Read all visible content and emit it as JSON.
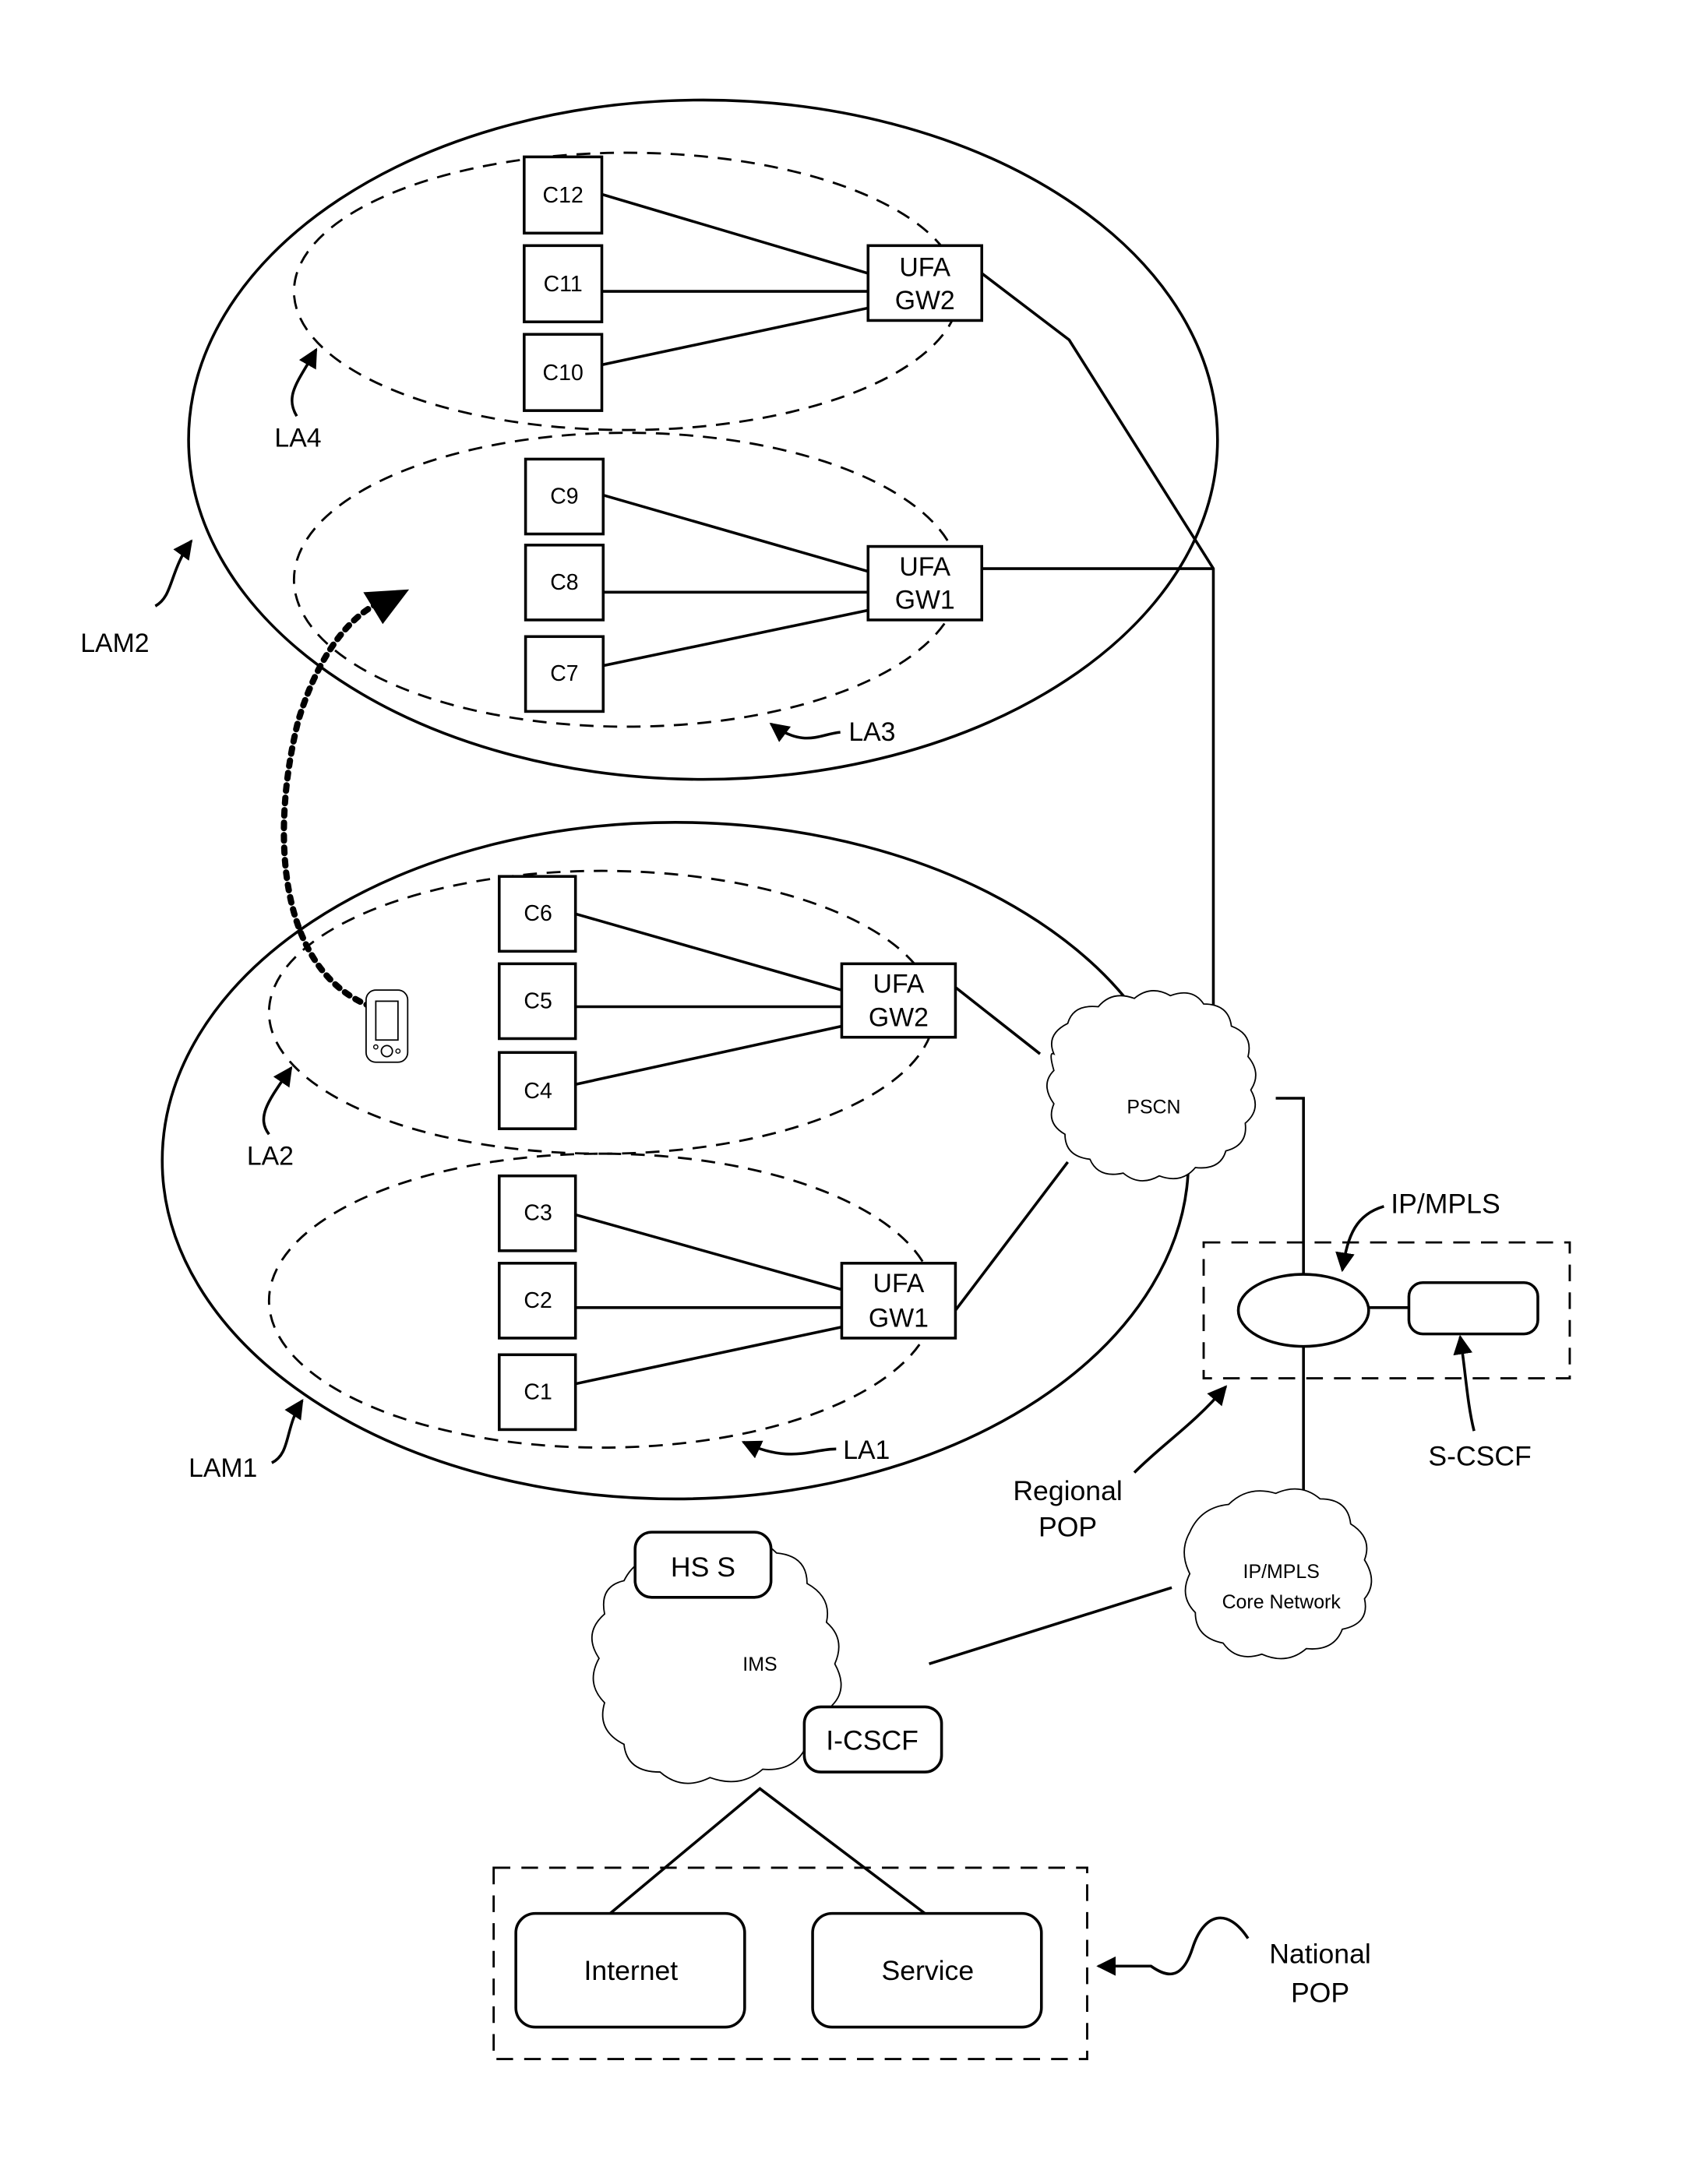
{
  "diagram": {
    "title": "",
    "lam2": {
      "label": "LAM2",
      "la4": {
        "label": "LA4",
        "cells": [
          "C12",
          "C11",
          "C10"
        ],
        "gateway": [
          "UFA",
          "GW2"
        ]
      },
      "la3": {
        "label": "LA3",
        "cells": [
          "C9",
          "C8",
          "C7"
        ],
        "gateway": [
          "UFA",
          "GW1"
        ]
      }
    },
    "lam1": {
      "label": "LAM1",
      "la2": {
        "label": "LA2",
        "cells": [
          "C6",
          "C5",
          "C4"
        ],
        "gateway": [
          "UFA",
          "GW2"
        ]
      },
      "la1": {
        "label": "LA1",
        "cells": [
          "C3",
          "C2",
          "C1"
        ],
        "gateway": [
          "UFA",
          "GW1"
        ]
      }
    },
    "pscn": "PSCN",
    "ip_mpls": "IP/MPLS",
    "s_cscf": "S-CSCF",
    "regional_pop": [
      "Regional",
      "POP"
    ],
    "core": [
      "IP/MPLS",
      "Core Network"
    ],
    "ims": {
      "label": "IMS",
      "hss": "HS S",
      "icscf": "I-CSCF"
    },
    "national_pop": {
      "label": [
        "National",
        "POP"
      ],
      "boxes": [
        "Internet",
        "Service"
      ]
    },
    "mobile_device": "mobile-phone-icon"
  }
}
